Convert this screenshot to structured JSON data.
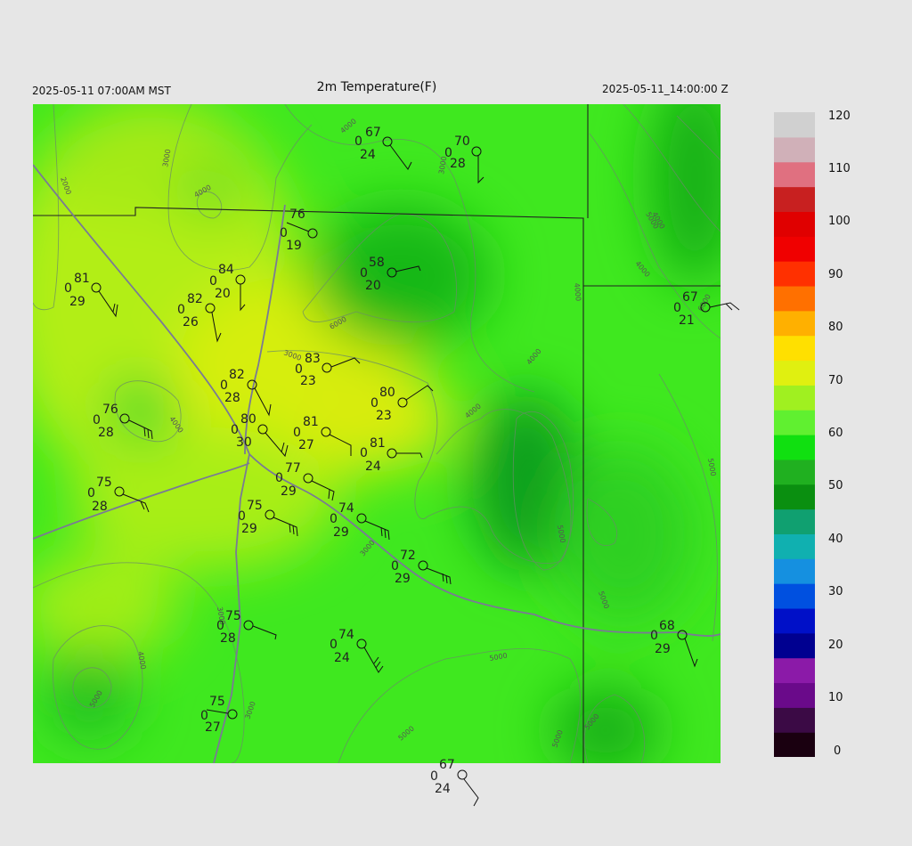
{
  "header": {
    "title": "2m Temperature(F)",
    "local_time": "2025-05-11 07:00AM MST",
    "utc_time": "2025-05-11_14:00:00 Z"
  },
  "colorbar": {
    "labels": [
      "120",
      "110",
      "100",
      "90",
      "80",
      "70",
      "60",
      "50",
      "40",
      "30",
      "20",
      "10",
      "0"
    ],
    "range": [
      0,
      120
    ],
    "colors": [
      "#1a0010",
      "#3b0a45",
      "#6a0a8a",
      "#8b1aa8",
      "#000090",
      "#0010c8",
      "#0050e0",
      "#1590e0",
      "#10b0b0",
      "#10a070",
      "#0a8f10",
      "#20b020",
      "#10e010",
      "#60f030",
      "#a0f020",
      "#e0f010",
      "#ffe000",
      "#ffb000",
      "#ff7000",
      "#ff3000",
      "#f00000",
      "#e00000",
      "#c82020",
      "#e07080",
      "#d0b0b8",
      "#d0d0d0"
    ]
  },
  "contour_labels": [
    "2000",
    "3000",
    "4000",
    "4000",
    "3000",
    "3000",
    "6000",
    "4000",
    "4000",
    "5000",
    "4000",
    "4000",
    "4000",
    "5000",
    "3000",
    "5000",
    "3000",
    "3000",
    "4000",
    "5000",
    "5000",
    "5000",
    "5000",
    "5000",
    "5000",
    "4000",
    "6000"
  ],
  "stations": [
    {
      "temp": "67",
      "precip": "0",
      "dew": "24"
    },
    {
      "temp": "70",
      "precip": "0",
      "dew": "28"
    },
    {
      "temp": "76",
      "precip": "0",
      "dew": "19"
    },
    {
      "temp": "58",
      "precip": "0",
      "dew": "20"
    },
    {
      "temp": "81",
      "precip": "0",
      "dew": "29"
    },
    {
      "temp": "84",
      "precip": "0",
      "dew": "20"
    },
    {
      "temp": "82",
      "precip": "0",
      "dew": "26"
    },
    {
      "temp": "67",
      "precip": "0",
      "dew": "21"
    },
    {
      "temp": "83",
      "precip": "0",
      "dew": "23"
    },
    {
      "temp": "82",
      "precip": "0",
      "dew": "28"
    },
    {
      "temp": "80",
      "precip": "0",
      "dew": "23"
    },
    {
      "temp": "76",
      "precip": "0",
      "dew": "28"
    },
    {
      "temp": "80",
      "precip": "0",
      "dew": "30"
    },
    {
      "temp": "81",
      "precip": "0",
      "dew": "27"
    },
    {
      "temp": "81",
      "precip": "0",
      "dew": "24"
    },
    {
      "temp": "77",
      "precip": "0",
      "dew": "29"
    },
    {
      "temp": "75",
      "precip": "0",
      "dew": "28"
    },
    {
      "temp": "75",
      "precip": "0",
      "dew": "29"
    },
    {
      "temp": "74",
      "precip": "0",
      "dew": "29"
    },
    {
      "temp": "72",
      "precip": "0",
      "dew": "29"
    },
    {
      "temp": "75",
      "precip": "0",
      "dew": "28"
    },
    {
      "temp": "74",
      "precip": "0",
      "dew": "24"
    },
    {
      "temp": "68",
      "precip": "0",
      "dew": "29"
    },
    {
      "temp": "75",
      "precip": "0",
      "dew": "27"
    },
    {
      "temp": "67",
      "precip": "0",
      "dew": "24"
    }
  ]
}
